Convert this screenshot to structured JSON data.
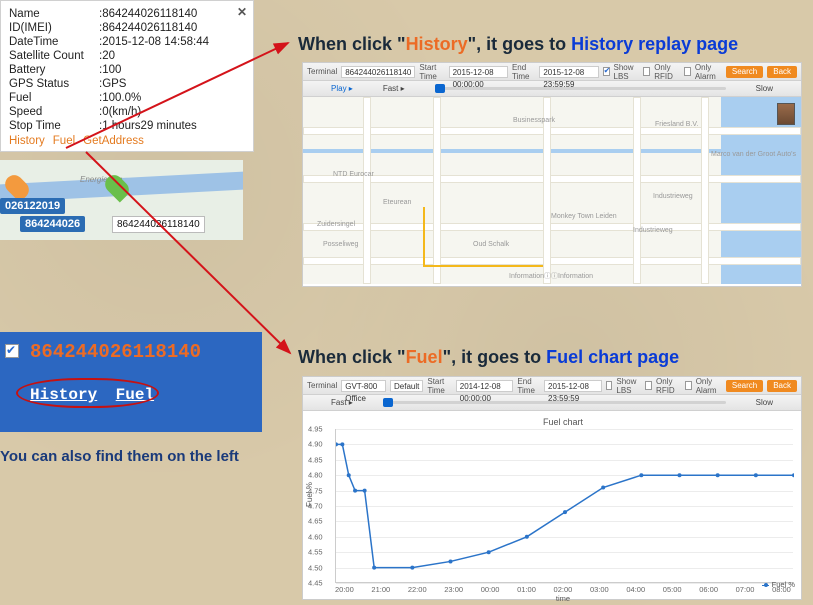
{
  "popup": {
    "rows": [
      {
        "k": "Name",
        "v": ":864244026118140"
      },
      {
        "k": "ID(IMEI)",
        "v": ":864244026118140"
      },
      {
        "k": "DateTime",
        "v": ":2015-12-08 14:58:44"
      },
      {
        "k": "Satellite Count",
        "v": ":20"
      },
      {
        "k": "Battery",
        "v": ":100"
      },
      {
        "k": "GPS Status",
        "v": ":GPS"
      },
      {
        "k": "Fuel",
        "v": ":100.0%"
      },
      {
        "k": "Speed",
        "v": ":0(km/h)"
      },
      {
        "k": "Stop Time",
        "v": ":1 hours29 minutes"
      }
    ],
    "actions": [
      "History",
      "Fuel",
      "GetAddress"
    ]
  },
  "mini_map": {
    "road": "Energieweg",
    "label1": "026122019",
    "label2": "864244026",
    "label3": "864244026118140"
  },
  "annot1_pre": "When click \"",
  "annot1_key": "History",
  "annot1_mid": "\", it goes to ",
  "annot1_post": "History replay page",
  "annot2_pre": "When click \"",
  "annot2_key": "Fuel",
  "annot2_mid": "\", it goes to ",
  "annot2_post": "Fuel chart page",
  "left_note": "You can also find them on the left",
  "side": {
    "device": "864244026118140",
    "links": [
      "History",
      "Fuel"
    ]
  },
  "ctrlbar": {
    "terminal_lbl": "Terminal",
    "terminal_val": "864244026118140",
    "terminal_val2": "GVT-800 Office",
    "default": "Default",
    "start_lbl": "Start Time",
    "start_val": "2015-12-08 00:00:00",
    "start_val2": "2014-12-08 00:00:00",
    "end_lbl": "End Time",
    "end_val": "2015-12-08 23:59:59",
    "showlbs": "Show LBS",
    "onlyrfid": "Only RFID",
    "onlyalarm": "Only Alarm",
    "search": "Search",
    "back": "Back",
    "play": "Play ▸",
    "fast": "Fast  ▸",
    "slow": "Slow"
  },
  "map_labels": {
    "a": "Businesspark",
    "b": "Friesland B.V.",
    "c": "NTD Eurocar",
    "d": "Eteurean",
    "e": "Monkey Town Leiden",
    "f": "Industrieweg",
    "g": "Zuidersingel",
    "h": "Posseliweg",
    "i": "Oud Schalk",
    "j": "Industrieweg",
    "k": "Marco van der Groot Auto's",
    "info": "InformationⓘⓘInformation"
  },
  "chart_data": {
    "type": "line",
    "title": "Fuel chart",
    "xlabel": "time",
    "ylabel": "Fuel %",
    "series_name": "Fuel %",
    "x": [
      "20:00",
      "21:00",
      "22:00",
      "23:00",
      "00:00",
      "01:00",
      "02:00",
      "03:00",
      "04:00",
      "05:00",
      "06:00",
      "07:00",
      "08:00"
    ],
    "y_ticks": [
      4.45,
      4.5,
      4.55,
      4.6,
      4.65,
      4.7,
      4.75,
      4.8,
      4.85,
      4.9,
      4.95
    ],
    "ylim": [
      4.45,
      4.95
    ],
    "values": [
      {
        "x": "20:00",
        "y": 4.9
      },
      {
        "x": "20:10",
        "y": 4.9
      },
      {
        "x": "20:20",
        "y": 4.8
      },
      {
        "x": "20:30",
        "y": 4.75
      },
      {
        "x": "20:45",
        "y": 4.75
      },
      {
        "x": "21:00",
        "y": 4.5
      },
      {
        "x": "22:00",
        "y": 4.5
      },
      {
        "x": "23:00",
        "y": 4.52
      },
      {
        "x": "00:00",
        "y": 4.55
      },
      {
        "x": "01:00",
        "y": 4.6
      },
      {
        "x": "02:00",
        "y": 4.68
      },
      {
        "x": "03:00",
        "y": 4.76
      },
      {
        "x": "04:00",
        "y": 4.8
      },
      {
        "x": "05:00",
        "y": 4.8
      },
      {
        "x": "06:00",
        "y": 4.8
      },
      {
        "x": "07:00",
        "y": 4.8
      },
      {
        "x": "08:00",
        "y": 4.8
      }
    ]
  }
}
